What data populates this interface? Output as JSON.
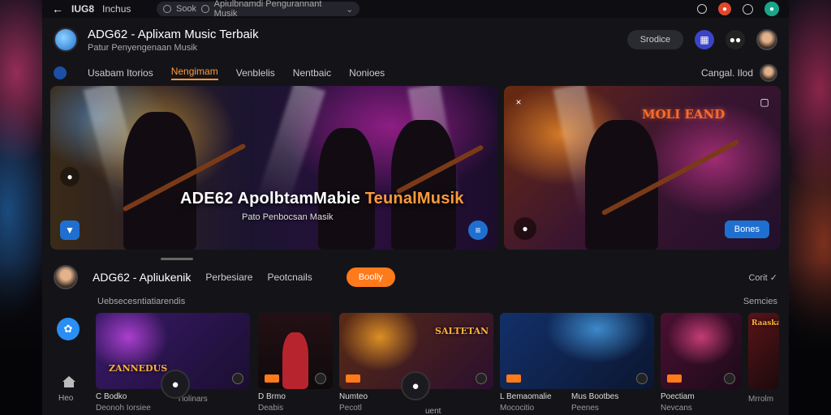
{
  "topbar": {
    "title": "IUG8",
    "menu": "Inchus",
    "search_text": "Sook",
    "search_hint": "Apiulbnamdi Pengurannant Musik"
  },
  "header": {
    "title": "ADG62 - Aplixam Music Terbaik",
    "subtitle": "Patur Penyengenaan Musik",
    "pill": "Srodice"
  },
  "nav": {
    "tabs": [
      {
        "label": "Usabam Itorios"
      },
      {
        "label": "Nengimam",
        "active": true
      },
      {
        "label": "Venblelis"
      },
      {
        "label": "Nentbaic"
      },
      {
        "label": "Nonioes"
      }
    ],
    "right_label": "Cangal. Ilod"
  },
  "hero": {
    "title_main": "ADE62  ApolbtamMabie ",
    "title_accent": "TeunalMusik",
    "subtitle": "Pato Penbocsan Masik",
    "sign_text": "",
    "side_sign": "MOLI EAND",
    "side_button": "Bones"
  },
  "section": {
    "title": "ADG62 - Apliukenik",
    "link1": "Perbesiare",
    "link2": "Peotcnails",
    "follow": "Boolly",
    "right": "Corit"
  },
  "list_head": {
    "left": "Uebsecesntiatiarendis",
    "right": "Semcies"
  },
  "rail": {
    "home_label": "Heo"
  },
  "cards": [
    {
      "text": "ZANNEDUS",
      "line1": "C Bodko",
      "line2": "Deonoh Iorsiee"
    },
    {
      "text": "",
      "line1": "",
      "line2": "Tlolinars"
    },
    {
      "text": "",
      "line1": "D Brmo",
      "line2": "Deabis"
    },
    {
      "text": "SALTETAN",
      "line1": "Numteo",
      "line2": "Pecotl"
    },
    {
      "text": "",
      "line1": "L Bemaomalie",
      "line2": "Mococitio"
    },
    {
      "text": "",
      "line1": "Mus Bootbes",
      "line2": "Peenes"
    },
    {
      "text": "",
      "line1": "Poectiam",
      "line2": "Nevcans"
    },
    {
      "text": "Raaska",
      "line1": "",
      "line2": "Mrrolm"
    }
  ],
  "fab_label": "uent",
  "colors": {
    "accent": "#ff9a3c",
    "primary": "#1f6fd0",
    "follow": "#ff7a1a"
  }
}
